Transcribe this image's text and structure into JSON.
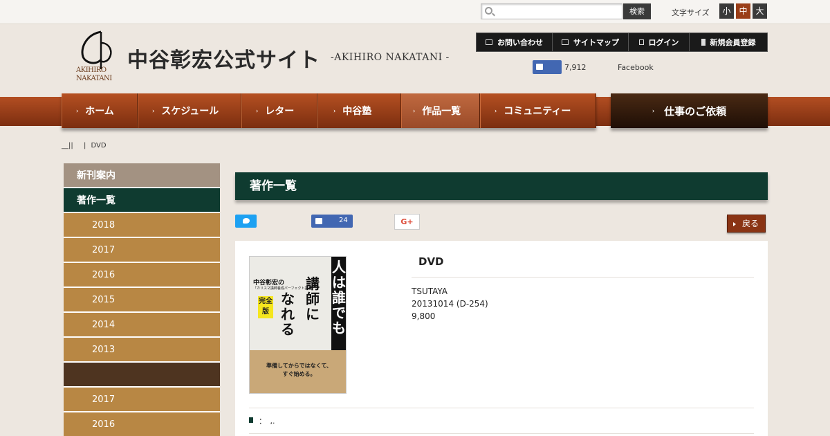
{
  "topbar": {
    "search_placeholder": "",
    "search_button": "検索",
    "font_size_label": "文字サイズ",
    "font_sizes": [
      "小",
      "中",
      "大"
    ]
  },
  "header": {
    "logo_text_line1": "AKIHIRO",
    "logo_text_line2": "NAKATANI",
    "site_title": "中谷彰宏公式サイト",
    "site_subtitle": "-AKIHIRO NAKATANI -",
    "util_links": [
      "お問い合わせ",
      "サイトマップ",
      "ログイン",
      "新規会員登録"
    ],
    "fb_like_count": "7,912",
    "fb_label": "Facebook"
  },
  "nav": {
    "items": [
      "ホーム",
      "スケジュール",
      "レター",
      "中谷塾",
      "作品一覧",
      "コミュニティー"
    ],
    "work_request": "仕事のご依頼"
  },
  "breadcrumb": {
    "home": "__||",
    "sep": "|",
    "current": "DVD"
  },
  "sidebar": {
    "new_releases": "新刊案内",
    "works": "著作一覧",
    "years_a": [
      "2018",
      "2017",
      "2016",
      "2015",
      "2014",
      "2013"
    ],
    "years_b": [
      "2017",
      "2016"
    ]
  },
  "main": {
    "heading": "著作一覧",
    "like_count": "24",
    "gplus": "G+",
    "back_label": "戻る",
    "product_title": "DVD",
    "publisher": "TSUTAYA",
    "release": "20131014 (D-254)",
    "price": "9,800",
    "note": "：　,."
  },
  "cover": {
    "subtitle": "中谷彰宏の",
    "subtitle2": "「カリスマ講師養成パーフェクト講座」",
    "ban": "完全版",
    "col_black": "人は誰でも",
    "col_mid": "講師に",
    "col_left": "なれる",
    "bottom_line1": "準備してからではなくて、",
    "bottom_line2": "すぐ始める。"
  },
  "colors": {
    "nav_brown": "#9a3e18",
    "dark_green": "#0f3b30",
    "sidebar_tan": "#b88744",
    "bg": "#ede7e0"
  }
}
